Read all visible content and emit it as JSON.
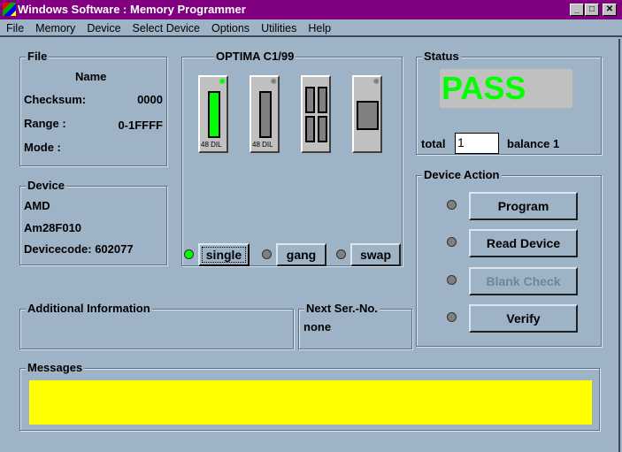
{
  "window": {
    "title": "Windows Software :  Memory Programmer",
    "min": "_",
    "max": "□",
    "close": "✕"
  },
  "menu": [
    "File",
    "Memory",
    "Device",
    "Select Device",
    "Options",
    "Utilities",
    "Help"
  ],
  "file": {
    "label": "File",
    "name_label": "Name",
    "checksum_label": "Checksum:",
    "checksum": "0000",
    "range_label": "Range :",
    "range": "0-1FFFF",
    "mode_label": "Mode :"
  },
  "device": {
    "label": "Device",
    "manufacturer": "AMD",
    "part": "Am28F010",
    "devicecode": "Devicecode: 602077"
  },
  "optima": {
    "label": "OPTIMA  C1/99",
    "sockets": [
      {
        "caption": "48 DIL",
        "active": true
      },
      {
        "caption": "48 DIL",
        "active": false
      },
      {
        "caption": "",
        "active": false
      },
      {
        "caption": "",
        "active": false
      }
    ],
    "modes": [
      {
        "label": "single",
        "active": true
      },
      {
        "label": "gang",
        "active": false
      },
      {
        "label": "swap",
        "active": false
      }
    ]
  },
  "status": {
    "label": "Status",
    "result": "PASS",
    "total_label": "total",
    "total": "1",
    "balance": "balance 1",
    "pass_color": "#00ff00"
  },
  "actions": {
    "label": "Device Action",
    "buttons": [
      {
        "label": "Program",
        "enabled": true
      },
      {
        "label": "Read Device",
        "enabled": true
      },
      {
        "label": "Blank Check",
        "enabled": false
      },
      {
        "label": "Verify",
        "enabled": true
      }
    ]
  },
  "additional": {
    "label": "Additional Information"
  },
  "nextser": {
    "label": "Next Ser.-No.",
    "value": "none"
  },
  "messages": {
    "label": "Messages",
    "color": "#ffff00"
  }
}
